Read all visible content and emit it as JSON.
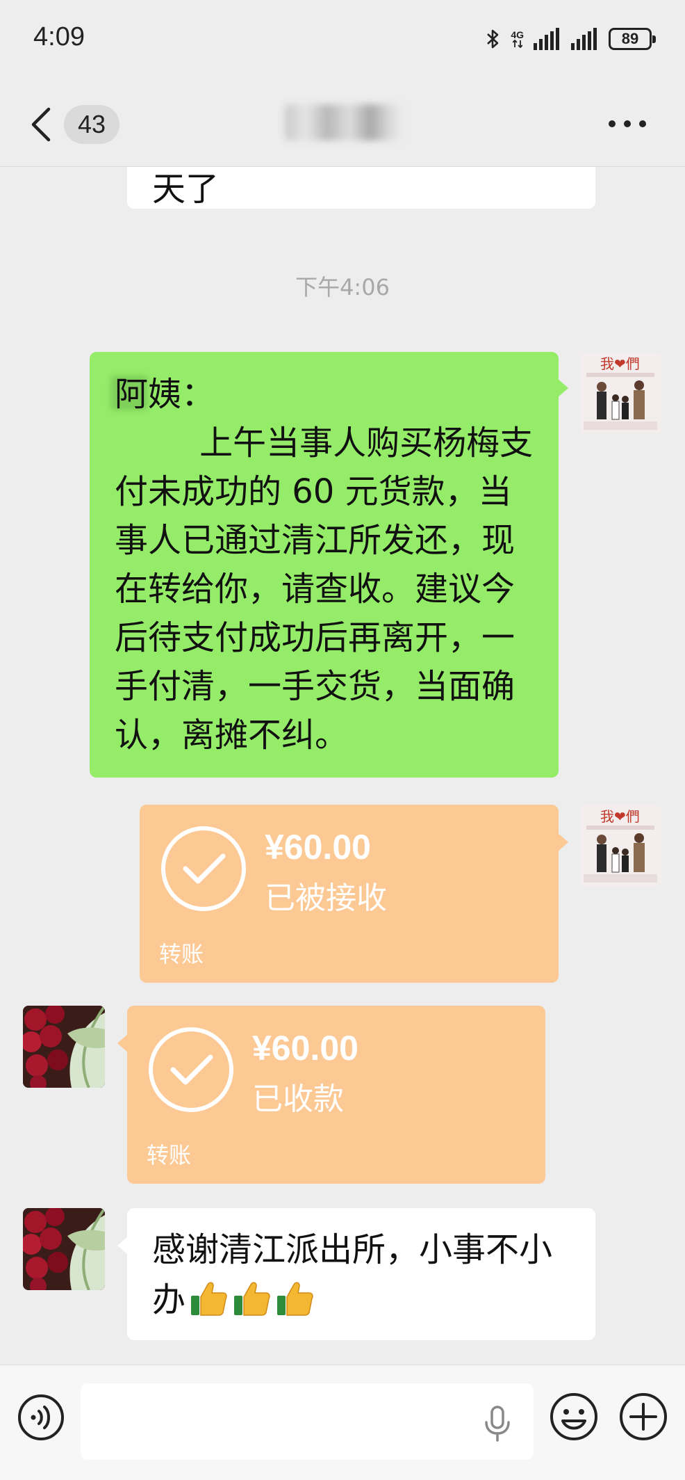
{
  "status_bar": {
    "time": "4:09",
    "network": "4G",
    "battery": "89"
  },
  "nav": {
    "unread_count": "43"
  },
  "chat": {
    "partial_previous_text": "天了",
    "timestamp": "下午4:06",
    "sent_message": "阿姨：\n        上午当事人购买杨梅支付未成功的 60 元货款，当事人已通过清江所发还，现在转给你，请查收。建议今后待支付成功后再离开，一手付清，一手交货，当面确认，离摊不纠。",
    "transfer_sent": {
      "amount": "¥60.00",
      "status": "已被接收",
      "label": "转账"
    },
    "transfer_received": {
      "amount": "¥60.00",
      "status": "已收款",
      "label": "转账"
    },
    "received_message": "感谢清江派出所，小事不小办",
    "received_emoji": [
      "thumbs-up",
      "thumbs-up",
      "thumbs-up"
    ]
  },
  "colors": {
    "background": "#ededed",
    "sent_bubble": "#95ec69",
    "transfer_bubble": "#fcc994",
    "received_bubble": "#ffffff"
  },
  "input_bar": {
    "value": "",
    "icons": [
      "voice-icon",
      "mic-icon",
      "emoji-icon",
      "plus-icon"
    ]
  }
}
